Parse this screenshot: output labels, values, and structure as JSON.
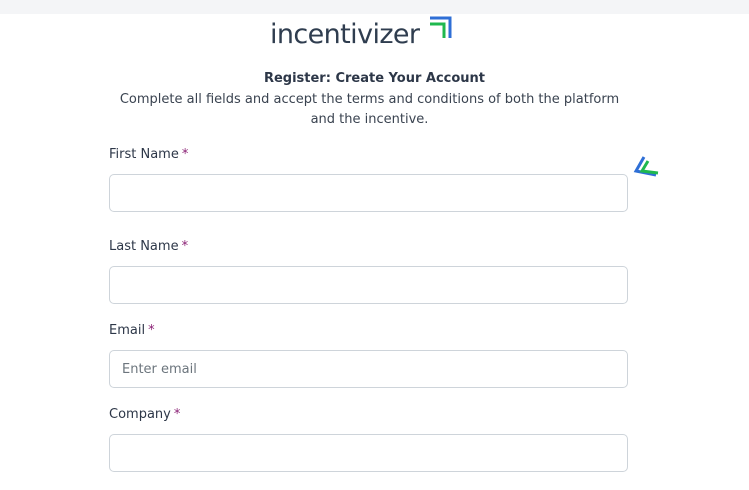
{
  "brand": {
    "logo_text": "incentivizer",
    "accent_colors": [
      "#1fb84e",
      "#2f6fd6"
    ]
  },
  "form": {
    "title": "Register: Create Your Account",
    "subtitle": "Complete all fields and accept the terms and conditions of both the platform and the incentive.",
    "required_marker": "*",
    "fields": [
      {
        "label": "First Name",
        "value": "",
        "placeholder": ""
      },
      {
        "label": "Last Name",
        "value": "",
        "placeholder": ""
      },
      {
        "label": "Email",
        "value": "",
        "placeholder": "Enter email"
      },
      {
        "label": "Company",
        "value": "",
        "placeholder": ""
      }
    ]
  },
  "icons": {
    "side_icon": "double-chevron-left-icon"
  }
}
